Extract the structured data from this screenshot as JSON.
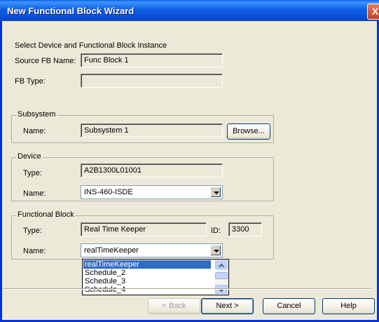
{
  "window": {
    "title": "New Functional Block Wizard",
    "close_glyph": "X"
  },
  "intro": "Select Device and Functional Block Instance",
  "source": {
    "fb_name_label": "Source FB Name:",
    "fb_name_value": "Func Block 1",
    "fb_type_label": "FB Type:",
    "fb_type_value": ""
  },
  "subsystem": {
    "group_title": "Subsystem",
    "name_label": "Name:",
    "name_value": "Subsystem 1",
    "browse_label": "Browse..."
  },
  "device": {
    "group_title": "Device",
    "type_label": "Type:",
    "type_value": "A2B1300L01001",
    "name_label": "Name:",
    "name_value": "INS-460-ISDE"
  },
  "functional_block": {
    "group_title": "Functional Block",
    "type_label": "Type:",
    "type_value": "Real Time Keeper",
    "id_label": "ID:",
    "id_value": "3300",
    "name_label": "Name:",
    "name_value": "realTimeKeeper",
    "dropdown_options": [
      "realTimeKeeper",
      "Schedule_2",
      "Schedule_3",
      "Schedule_4"
    ]
  },
  "buttons": {
    "back": "< Back",
    "next": "Next >",
    "cancel": "Cancel",
    "help": "Help"
  }
}
